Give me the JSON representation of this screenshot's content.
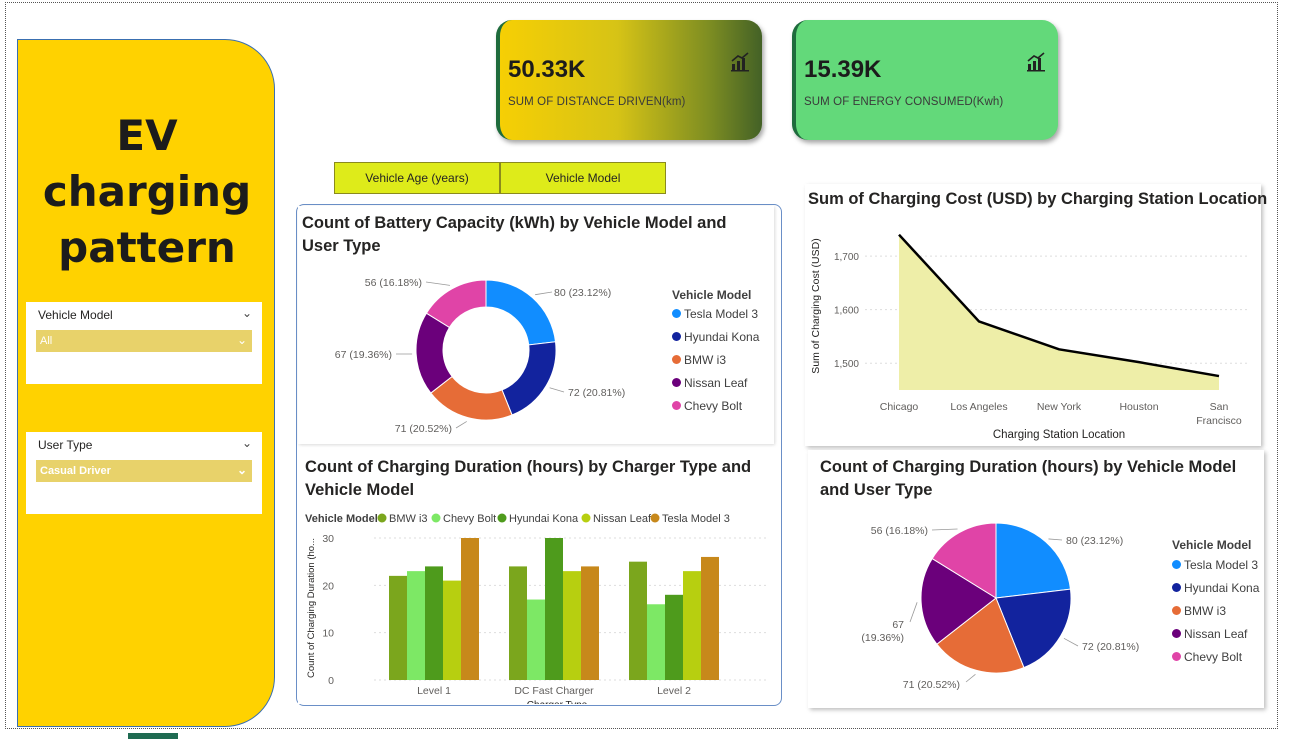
{
  "title_line1": "EV charging",
  "title_line2": "pattern",
  "slicers": [
    {
      "label": "Vehicle Model",
      "value": "All"
    },
    {
      "label": "User Type",
      "value": "Casual Driver"
    }
  ],
  "kpis": [
    {
      "value": "50.33K",
      "label": "SUM OF DISTANCE DRIVEN(km)"
    },
    {
      "value": "15.39K",
      "label": "SUM OF ENERGY CONSUMED(Kwh)"
    }
  ],
  "buttons": [
    "Vehicle Age (years)",
    "Vehicle Model"
  ],
  "donut_title": "Count of Battery Capacity (kWh) by Vehicle Model and User Type",
  "line_title": "Sum of Charging Cost (USD) by Charging Station Location",
  "bar_title": "Count of Charging Duration (hours) by Charger Type and Vehicle Model",
  "pie_title": "Count of Charging Duration (hours) by Vehicle Model and User Type",
  "legend_title": "Vehicle Model",
  "colors": {
    "tesla": "#118DFF",
    "hyundai": "#12239E",
    "bmw": "#E66C37",
    "nissan": "#6B007B",
    "chevy": "#E044A7",
    "bar_bmw": "#7BA61D",
    "bar_chevy": "#7DE865",
    "bar_hyundai": "#4E9B1C",
    "bar_nissan": "#B7CF10",
    "bar_tesla": "#C7881B"
  },
  "chart_data": [
    {
      "type": "pie",
      "variant": "donut",
      "title": "Count of Battery Capacity (kWh) by Vehicle Model and User Type",
      "legend_title": "Vehicle Model",
      "categories": [
        "Tesla Model 3",
        "Hyundai Kona",
        "BMW i3",
        "Nissan Leaf",
        "Chevy Bolt"
      ],
      "values": [
        80,
        72,
        71,
        67,
        56
      ],
      "labels": [
        "80 (23.12%)",
        "72 (20.81%)",
        "71 (20.52%)",
        "67 (19.36%)",
        "56 (16.18%)"
      ]
    },
    {
      "type": "area",
      "title": "Sum of Charging Cost (USD) by Charging Station Location",
      "xlabel": "Charging Station Location",
      "ylabel": "Sum of Charging Cost (USD)",
      "categories": [
        "Chicago",
        "Los Angeles",
        "New York",
        "Houston",
        "San Francisco"
      ],
      "values": [
        1740,
        1578,
        1526,
        1502,
        1476
      ],
      "yticks": [
        "1,500",
        "1,600",
        "1,700"
      ],
      "ylim": [
        1450,
        1760
      ]
    },
    {
      "type": "bar",
      "title": "Count of Charging Duration (hours) by Charger Type and Vehicle Model",
      "xlabel": "Charger Type",
      "ylabel": "Count of Charging Duration (ho...",
      "legend_title": "Vehicle Model",
      "categories": [
        "Level 1",
        "DC Fast Charger",
        "Level 2"
      ],
      "series": [
        {
          "name": "BMW i3",
          "values": [
            22,
            24,
            25
          ]
        },
        {
          "name": "Chevy Bolt",
          "values": [
            23,
            17,
            16
          ]
        },
        {
          "name": "Hyundai Kona",
          "values": [
            24,
            30,
            18
          ]
        },
        {
          "name": "Nissan Leaf",
          "values": [
            21,
            23,
            23
          ]
        },
        {
          "name": "Tesla Model 3",
          "values": [
            30,
            24,
            26
          ]
        }
      ],
      "yticks": [
        "0",
        "10",
        "20",
        "30"
      ],
      "ylim": [
        0,
        30
      ]
    },
    {
      "type": "pie",
      "title": "Count of Charging Duration (hours) by Vehicle Model and User Type",
      "legend_title": "Vehicle Model",
      "categories": [
        "Tesla Model 3",
        "Hyundai Kona",
        "BMW i3",
        "Nissan Leaf",
        "Chevy Bolt"
      ],
      "values": [
        80,
        72,
        71,
        67,
        56
      ],
      "labels": [
        "80 (23.12%)",
        "72 (20.81%)",
        "71 (20.52%)",
        "67 (19.36%)",
        "56 (16.18%)"
      ]
    }
  ]
}
